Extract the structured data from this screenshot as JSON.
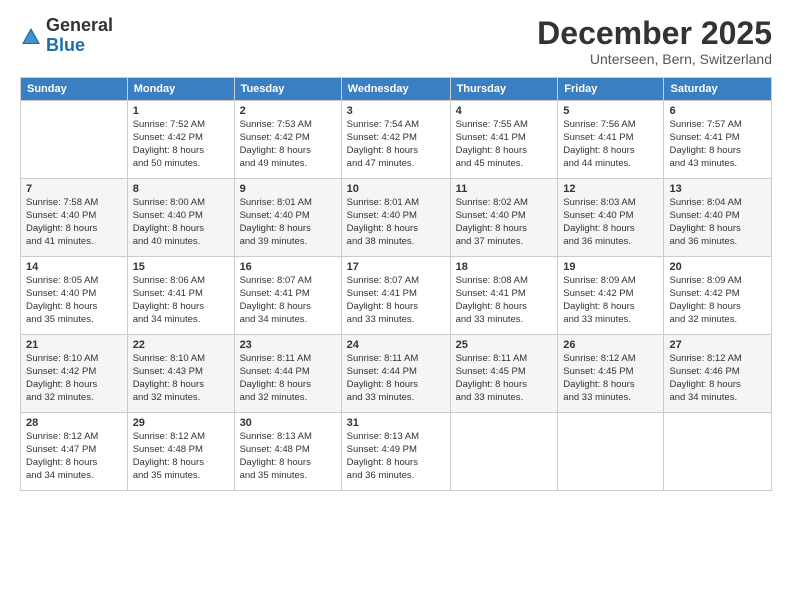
{
  "logo": {
    "general": "General",
    "blue": "Blue"
  },
  "title": "December 2025",
  "subtitle": "Unterseen, Bern, Switzerland",
  "days_header": [
    "Sunday",
    "Monday",
    "Tuesday",
    "Wednesday",
    "Thursday",
    "Friday",
    "Saturday"
  ],
  "weeks": [
    [
      {
        "day": "",
        "info": ""
      },
      {
        "day": "1",
        "info": "Sunrise: 7:52 AM\nSunset: 4:42 PM\nDaylight: 8 hours\nand 50 minutes."
      },
      {
        "day": "2",
        "info": "Sunrise: 7:53 AM\nSunset: 4:42 PM\nDaylight: 8 hours\nand 49 minutes."
      },
      {
        "day": "3",
        "info": "Sunrise: 7:54 AM\nSunset: 4:42 PM\nDaylight: 8 hours\nand 47 minutes."
      },
      {
        "day": "4",
        "info": "Sunrise: 7:55 AM\nSunset: 4:41 PM\nDaylight: 8 hours\nand 45 minutes."
      },
      {
        "day": "5",
        "info": "Sunrise: 7:56 AM\nSunset: 4:41 PM\nDaylight: 8 hours\nand 44 minutes."
      },
      {
        "day": "6",
        "info": "Sunrise: 7:57 AM\nSunset: 4:41 PM\nDaylight: 8 hours\nand 43 minutes."
      }
    ],
    [
      {
        "day": "7",
        "info": "Sunrise: 7:58 AM\nSunset: 4:40 PM\nDaylight: 8 hours\nand 41 minutes."
      },
      {
        "day": "8",
        "info": "Sunrise: 8:00 AM\nSunset: 4:40 PM\nDaylight: 8 hours\nand 40 minutes."
      },
      {
        "day": "9",
        "info": "Sunrise: 8:01 AM\nSunset: 4:40 PM\nDaylight: 8 hours\nand 39 minutes."
      },
      {
        "day": "10",
        "info": "Sunrise: 8:01 AM\nSunset: 4:40 PM\nDaylight: 8 hours\nand 38 minutes."
      },
      {
        "day": "11",
        "info": "Sunrise: 8:02 AM\nSunset: 4:40 PM\nDaylight: 8 hours\nand 37 minutes."
      },
      {
        "day": "12",
        "info": "Sunrise: 8:03 AM\nSunset: 4:40 PM\nDaylight: 8 hours\nand 36 minutes."
      },
      {
        "day": "13",
        "info": "Sunrise: 8:04 AM\nSunset: 4:40 PM\nDaylight: 8 hours\nand 36 minutes."
      }
    ],
    [
      {
        "day": "14",
        "info": "Sunrise: 8:05 AM\nSunset: 4:40 PM\nDaylight: 8 hours\nand 35 minutes."
      },
      {
        "day": "15",
        "info": "Sunrise: 8:06 AM\nSunset: 4:41 PM\nDaylight: 8 hours\nand 34 minutes."
      },
      {
        "day": "16",
        "info": "Sunrise: 8:07 AM\nSunset: 4:41 PM\nDaylight: 8 hours\nand 34 minutes."
      },
      {
        "day": "17",
        "info": "Sunrise: 8:07 AM\nSunset: 4:41 PM\nDaylight: 8 hours\nand 33 minutes."
      },
      {
        "day": "18",
        "info": "Sunrise: 8:08 AM\nSunset: 4:41 PM\nDaylight: 8 hours\nand 33 minutes."
      },
      {
        "day": "19",
        "info": "Sunrise: 8:09 AM\nSunset: 4:42 PM\nDaylight: 8 hours\nand 33 minutes."
      },
      {
        "day": "20",
        "info": "Sunrise: 8:09 AM\nSunset: 4:42 PM\nDaylight: 8 hours\nand 32 minutes."
      }
    ],
    [
      {
        "day": "21",
        "info": "Sunrise: 8:10 AM\nSunset: 4:42 PM\nDaylight: 8 hours\nand 32 minutes."
      },
      {
        "day": "22",
        "info": "Sunrise: 8:10 AM\nSunset: 4:43 PM\nDaylight: 8 hours\nand 32 minutes."
      },
      {
        "day": "23",
        "info": "Sunrise: 8:11 AM\nSunset: 4:44 PM\nDaylight: 8 hours\nand 32 minutes."
      },
      {
        "day": "24",
        "info": "Sunrise: 8:11 AM\nSunset: 4:44 PM\nDaylight: 8 hours\nand 33 minutes."
      },
      {
        "day": "25",
        "info": "Sunrise: 8:11 AM\nSunset: 4:45 PM\nDaylight: 8 hours\nand 33 minutes."
      },
      {
        "day": "26",
        "info": "Sunrise: 8:12 AM\nSunset: 4:45 PM\nDaylight: 8 hours\nand 33 minutes."
      },
      {
        "day": "27",
        "info": "Sunrise: 8:12 AM\nSunset: 4:46 PM\nDaylight: 8 hours\nand 34 minutes."
      }
    ],
    [
      {
        "day": "28",
        "info": "Sunrise: 8:12 AM\nSunset: 4:47 PM\nDaylight: 8 hours\nand 34 minutes."
      },
      {
        "day": "29",
        "info": "Sunrise: 8:12 AM\nSunset: 4:48 PM\nDaylight: 8 hours\nand 35 minutes."
      },
      {
        "day": "30",
        "info": "Sunrise: 8:13 AM\nSunset: 4:48 PM\nDaylight: 8 hours\nand 35 minutes."
      },
      {
        "day": "31",
        "info": "Sunrise: 8:13 AM\nSunset: 4:49 PM\nDaylight: 8 hours\nand 36 minutes."
      },
      {
        "day": "",
        "info": ""
      },
      {
        "day": "",
        "info": ""
      },
      {
        "day": "",
        "info": ""
      }
    ]
  ]
}
